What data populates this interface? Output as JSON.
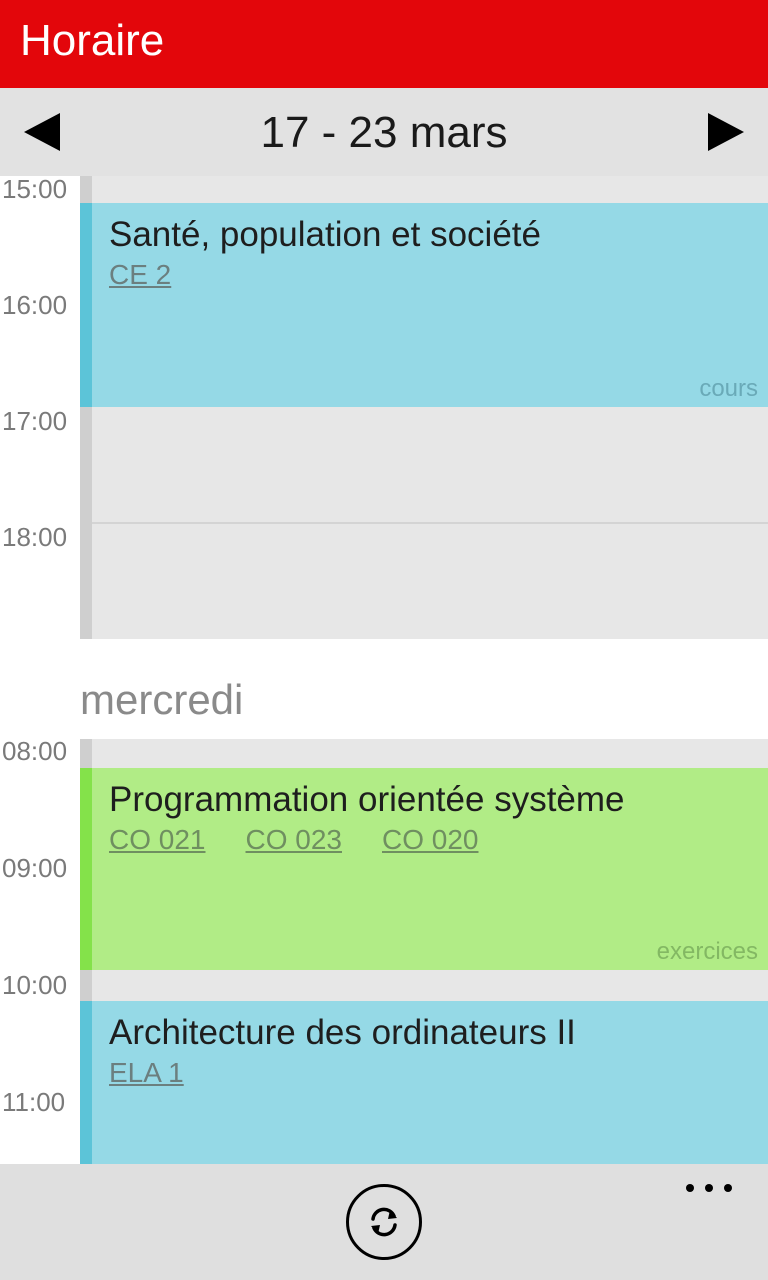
{
  "app": {
    "title": "Horaire"
  },
  "week": {
    "range_label": "17 - 23 mars"
  },
  "schedule": {
    "times_day1": [
      "15:00",
      "16:00",
      "17:00",
      "18:00"
    ],
    "day2_label": "mercredi",
    "times_day2": [
      "08:00",
      "09:00",
      "10:00",
      "11:00"
    ],
    "events": [
      {
        "title": "Santé, population et société",
        "rooms": [
          "CE 2"
        ],
        "type": "cours",
        "color": "#95d9e6"
      },
      {
        "title": "Programmation orientée système",
        "rooms": [
          "CO 021",
          "CO 023",
          "CO 020"
        ],
        "type": "exercices",
        "color": "#b1ec86"
      },
      {
        "title": "Architecture des ordinateurs II",
        "rooms": [
          "ELA 1"
        ],
        "type": "",
        "color": "#95d9e6"
      }
    ]
  },
  "icons": {
    "prev": "triangle-left-icon",
    "next": "triangle-right-icon",
    "refresh": "refresh-icon",
    "more": "more-ellipsis-icon"
  },
  "colors": {
    "accent": "#e3060b"
  }
}
